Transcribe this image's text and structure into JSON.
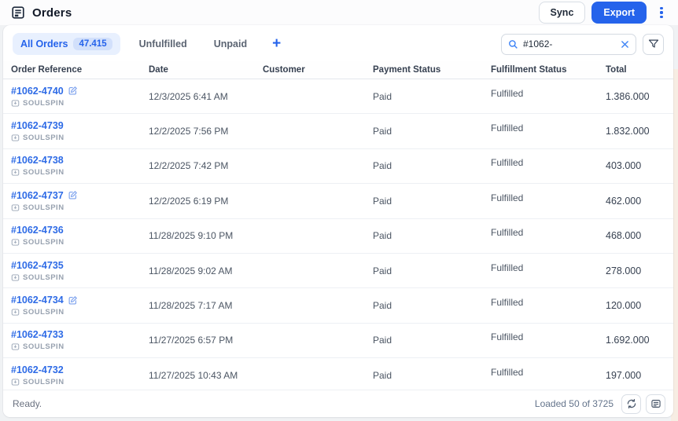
{
  "header": {
    "title": "Orders",
    "sync_label": "Sync",
    "export_label": "Export"
  },
  "tabs": {
    "items": [
      {
        "label": "All Orders",
        "badge": "47.415",
        "active": true
      },
      {
        "label": "Unfulfilled",
        "active": false
      },
      {
        "label": "Unpaid",
        "active": false
      }
    ],
    "add_view": "+"
  },
  "search": {
    "value": "#1062-"
  },
  "icons": [
    "orders-icon",
    "kebab-menu-icon",
    "search-icon",
    "clear-icon",
    "filter-funnel-icon",
    "edit-pencil-icon",
    "source-tag-icon",
    "refresh-icon",
    "log-panel-icon",
    "plus-icon"
  ],
  "colors": {
    "accent": "#2563eb",
    "link": "#2e6be6",
    "active_tab_bg": "#e8f0fe",
    "badge_bg": "#d2e0fb",
    "row_border": "#edf0f4"
  },
  "table": {
    "columns": [
      "Order Reference",
      "Date",
      "Customer",
      "Payment Status",
      "Fulfillment Status",
      "Total"
    ],
    "rows": [
      {
        "reference": "#1062-4740",
        "editable": true,
        "source": "SOULSPIN",
        "date": "12/3/2025 6:41 AM",
        "customer": "",
        "payment": "Paid",
        "fulfillment": "Fulfilled",
        "total": "1.386.000"
      },
      {
        "reference": "#1062-4739",
        "editable": false,
        "source": "SOULSPIN",
        "date": "12/2/2025 7:56 PM",
        "customer": "",
        "payment": "Paid",
        "fulfillment": "Fulfilled",
        "total": "1.832.000"
      },
      {
        "reference": "#1062-4738",
        "editable": false,
        "source": "SOULSPIN",
        "date": "12/2/2025 7:42 PM",
        "customer": "",
        "payment": "Paid",
        "fulfillment": "Fulfilled",
        "total": "403.000"
      },
      {
        "reference": "#1062-4737",
        "editable": true,
        "source": "SOULSPIN",
        "date": "12/2/2025 6:19 PM",
        "customer": "",
        "payment": "Paid",
        "fulfillment": "Fulfilled",
        "total": "462.000"
      },
      {
        "reference": "#1062-4736",
        "editable": false,
        "source": "SOULSPIN",
        "date": "11/28/2025 9:10 PM",
        "customer": "",
        "payment": "Paid",
        "fulfillment": "Fulfilled",
        "total": "468.000"
      },
      {
        "reference": "#1062-4735",
        "editable": false,
        "source": "SOULSPIN",
        "date": "11/28/2025 9:02 AM",
        "customer": "",
        "payment": "Paid",
        "fulfillment": "Fulfilled",
        "total": "278.000"
      },
      {
        "reference": "#1062-4734",
        "editable": true,
        "source": "SOULSPIN",
        "date": "11/28/2025 7:17 AM",
        "customer": "",
        "payment": "Paid",
        "fulfillment": "Fulfilled",
        "total": "120.000"
      },
      {
        "reference": "#1062-4733",
        "editable": false,
        "source": "SOULSPIN",
        "date": "11/27/2025 6:57 PM",
        "customer": "",
        "payment": "Paid",
        "fulfillment": "Fulfilled",
        "total": "1.692.000"
      },
      {
        "reference": "#1062-4732",
        "editable": false,
        "source": "SOULSPIN",
        "date": "11/27/2025 10:43 AM",
        "customer": "",
        "payment": "Paid",
        "fulfillment": "Fulfilled",
        "total": "197.000"
      }
    ]
  },
  "footer": {
    "status": "Ready.",
    "loaded": "Loaded 50 of 3725"
  }
}
